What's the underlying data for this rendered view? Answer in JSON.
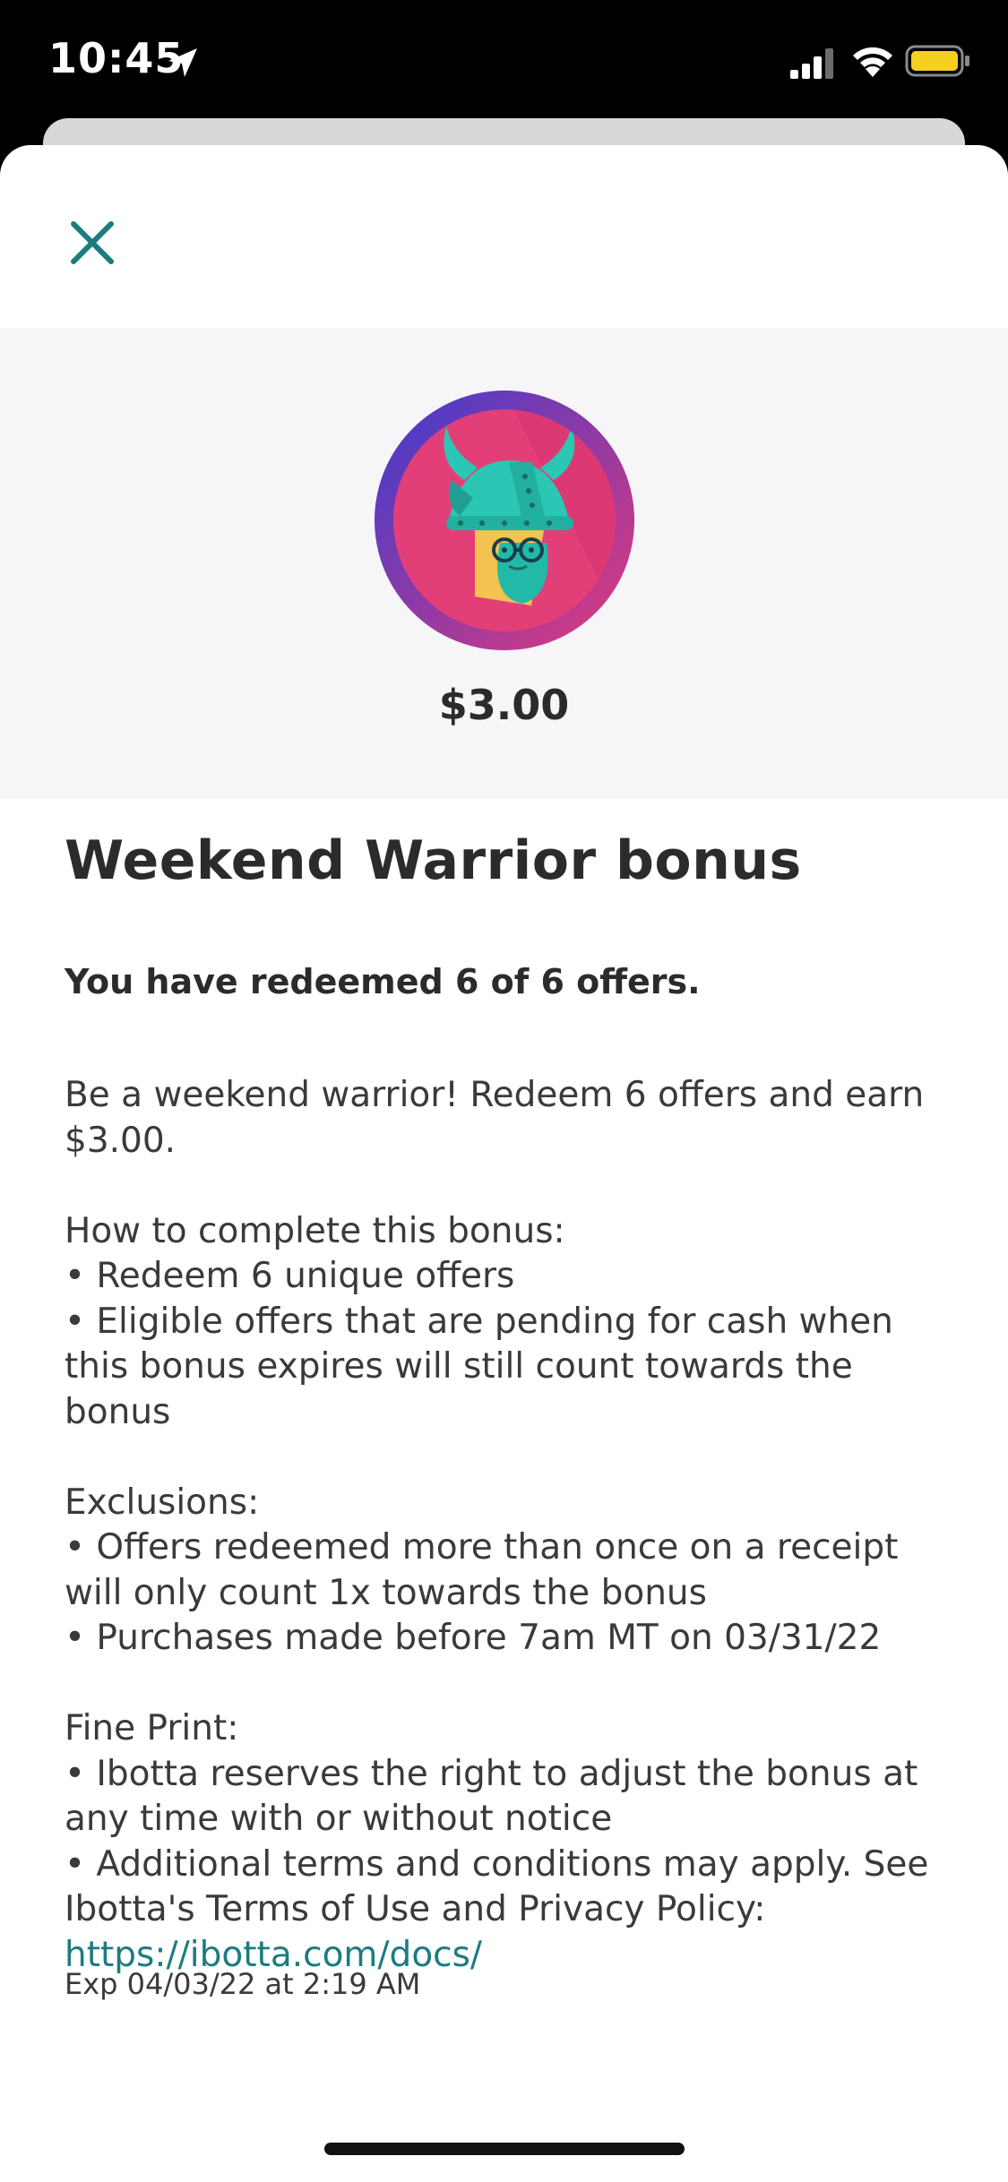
{
  "status_bar": {
    "time": "10:45",
    "icons": [
      "location-arrow-icon",
      "cellular-signal-icon",
      "wifi-icon",
      "battery-icon"
    ],
    "battery_color": "#f5d020"
  },
  "header": {
    "close_icon": "close-icon",
    "accent_color": "#1b7c80"
  },
  "hero": {
    "badge_icon": "viking-warrior-badge-icon",
    "amount": "$3.00"
  },
  "bonus": {
    "title": "Weekend Warrior bonus",
    "progress": "You have redeemed 6 of 6 offers.",
    "intro_line": "Be a weekend warrior! Redeem 6 offers and earn $3.00.",
    "how_heading": "How to complete this bonus:",
    "how_items": [
      "• Redeem 6 unique offers",
      "• Eligible offers that are pending for cash when this bonus expires will still count towards the bonus"
    ],
    "exclusions_heading": "Exclusions:",
    "exclusions_items": [
      "• Offers redeemed more than once on a receipt will only count 1x towards the bonus",
      "• Purchases made before 7am MT on 03/31/22"
    ],
    "fine_print_heading": "Fine Print:",
    "fine_print_items": [
      "• Ibotta reserves the right to adjust the bonus at any time with or without notice"
    ],
    "terms_text": "• Additional terms and conditions may apply. See Ibotta's Terms of Use and Privacy Policy: ",
    "terms_link": "https://ibotta.com/docs/",
    "expiry": "Exp 04/03/22 at 2:19 AM"
  }
}
